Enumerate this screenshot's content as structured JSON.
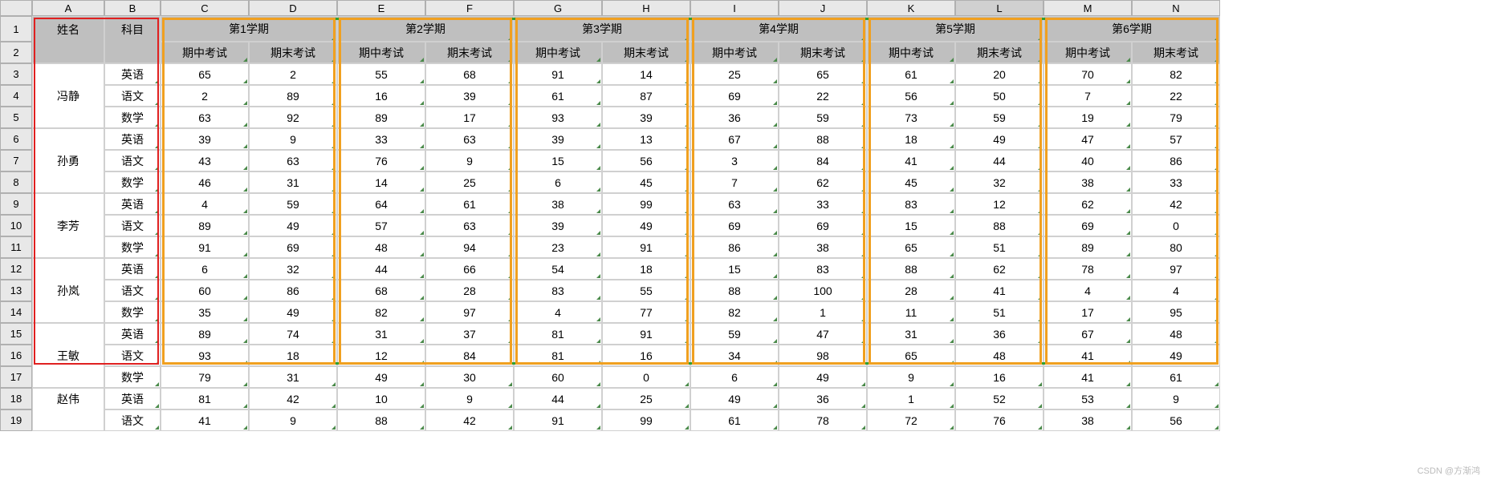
{
  "columns": [
    "A",
    "B",
    "C",
    "D",
    "E",
    "F",
    "G",
    "H",
    "I",
    "J",
    "K",
    "L",
    "M",
    "N"
  ],
  "selected_column_index": 11,
  "row_numbers": [
    1,
    2,
    3,
    4,
    5,
    6,
    7,
    8,
    9,
    10,
    11,
    12,
    13,
    14,
    15,
    16,
    17,
    18,
    19
  ],
  "header": {
    "name": "姓名",
    "subject": "科目",
    "semesters": [
      "第1学期",
      "第2学期",
      "第3学期",
      "第4学期",
      "第5学期",
      "第6学期"
    ],
    "exam_mid": "期中考试",
    "exam_final": "期末考试"
  },
  "students": [
    {
      "name": "冯静",
      "rows": [
        {
          "subject": "英语",
          "scores": [
            65,
            2,
            55,
            68,
            91,
            14,
            25,
            65,
            61,
            20,
            70,
            82
          ]
        },
        {
          "subject": "语文",
          "scores": [
            2,
            89,
            16,
            39,
            61,
            87,
            69,
            22,
            56,
            50,
            7,
            22
          ]
        },
        {
          "subject": "数学",
          "scores": [
            63,
            92,
            89,
            17,
            93,
            39,
            36,
            59,
            73,
            59,
            19,
            79
          ]
        }
      ]
    },
    {
      "name": "孙勇",
      "rows": [
        {
          "subject": "英语",
          "scores": [
            39,
            9,
            33,
            63,
            39,
            13,
            67,
            88,
            18,
            49,
            47,
            57
          ]
        },
        {
          "subject": "语文",
          "scores": [
            43,
            63,
            76,
            9,
            15,
            56,
            3,
            84,
            41,
            44,
            40,
            86
          ]
        },
        {
          "subject": "数学",
          "scores": [
            46,
            31,
            14,
            25,
            6,
            45,
            7,
            62,
            45,
            32,
            38,
            33
          ]
        }
      ]
    },
    {
      "name": "李芳",
      "rows": [
        {
          "subject": "英语",
          "scores": [
            4,
            59,
            64,
            61,
            38,
            99,
            63,
            33,
            83,
            12,
            62,
            42
          ]
        },
        {
          "subject": "语文",
          "scores": [
            89,
            49,
            57,
            63,
            39,
            49,
            69,
            69,
            15,
            88,
            69,
            0
          ]
        },
        {
          "subject": "数学",
          "scores": [
            91,
            69,
            48,
            94,
            23,
            91,
            86,
            38,
            65,
            51,
            89,
            80
          ]
        }
      ]
    },
    {
      "name": "孙岚",
      "rows": [
        {
          "subject": "英语",
          "scores": [
            6,
            32,
            44,
            66,
            54,
            18,
            15,
            83,
            88,
            62,
            78,
            97
          ]
        },
        {
          "subject": "语文",
          "scores": [
            60,
            86,
            68,
            28,
            83,
            55,
            88,
            100,
            28,
            41,
            4,
            4
          ]
        },
        {
          "subject": "数学",
          "scores": [
            35,
            49,
            82,
            97,
            4,
            77,
            82,
            1,
            11,
            51,
            17,
            95
          ]
        }
      ]
    },
    {
      "name": "王敏",
      "rows": [
        {
          "subject": "英语",
          "scores": [
            89,
            74,
            31,
            37,
            81,
            91,
            59,
            47,
            31,
            36,
            67,
            48
          ]
        },
        {
          "subject": "语文",
          "scores": [
            93,
            18,
            12,
            84,
            81,
            16,
            34,
            98,
            65,
            48,
            41,
            49
          ]
        },
        {
          "subject": "数学",
          "scores": [
            79,
            31,
            49,
            30,
            60,
            0,
            6,
            49,
            9,
            16,
            41,
            61
          ]
        }
      ]
    },
    {
      "name": "赵伟",
      "rows": [
        {
          "subject": "英语",
          "scores": [
            81,
            42,
            10,
            9,
            44,
            25,
            49,
            36,
            1,
            52,
            53,
            9
          ]
        },
        {
          "subject": "语文",
          "scores": [
            41,
            9,
            88,
            42,
            91,
            99,
            61,
            78,
            72,
            76,
            38,
            56
          ]
        }
      ]
    }
  ],
  "watermark": "CSDN @方渐鸿"
}
